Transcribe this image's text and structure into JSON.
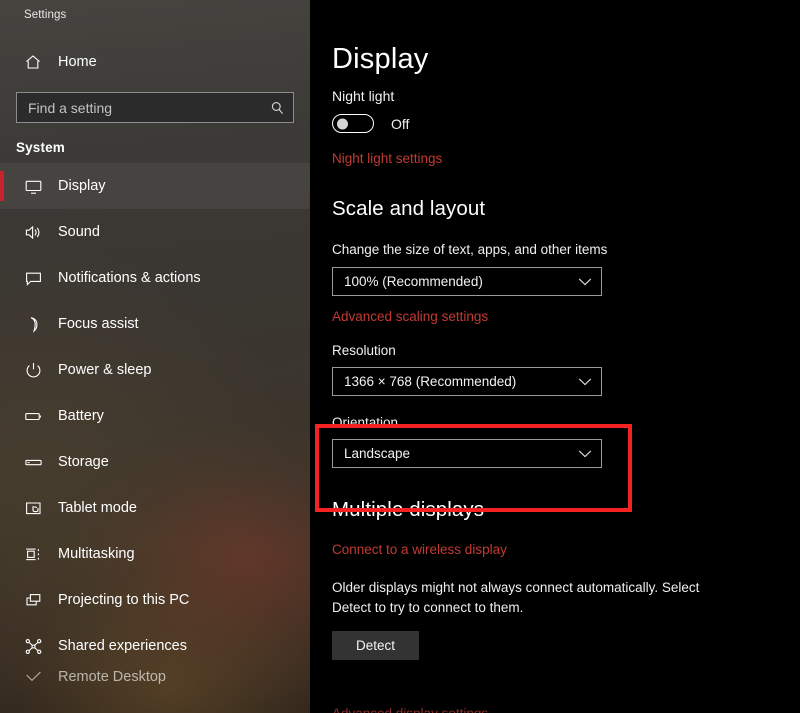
{
  "window": {
    "title": "Settings"
  },
  "sidebar": {
    "home_label": "Home",
    "home_icon": "home-icon",
    "search": {
      "placeholder": "Find a setting",
      "value": "",
      "icon": "search-icon"
    },
    "group_label": "System",
    "accent_color": "#c8232c",
    "items": [
      {
        "label": "Display",
        "icon": "monitor-icon",
        "selected": true
      },
      {
        "label": "Sound",
        "icon": "speaker-icon",
        "selected": false
      },
      {
        "label": "Notifications & actions",
        "icon": "chat-bubble-icon",
        "selected": false
      },
      {
        "label": "Focus assist",
        "icon": "moon-icon",
        "selected": false
      },
      {
        "label": "Power & sleep",
        "icon": "power-icon",
        "selected": false
      },
      {
        "label": "Battery",
        "icon": "battery-icon",
        "selected": false
      },
      {
        "label": "Storage",
        "icon": "storage-icon",
        "selected": false
      },
      {
        "label": "Tablet mode",
        "icon": "tablet-hand-icon",
        "selected": false
      },
      {
        "label": "Multitasking",
        "icon": "multitasking-icon",
        "selected": false
      },
      {
        "label": "Projecting to this PC",
        "icon": "projecting-icon",
        "selected": false
      },
      {
        "label": "Shared experiences",
        "icon": "share-nodes-icon",
        "selected": false
      }
    ],
    "clipped_item": {
      "label": "Remote Desktop",
      "icon": "remote-desktop-icon"
    }
  },
  "main": {
    "page_title": "Display",
    "night_light": {
      "label": "Night light",
      "state": "Off",
      "enabled": false,
      "settings_link": "Night light settings"
    },
    "scale_and_layout": {
      "heading": "Scale and layout",
      "scale_label": "Change the size of text, apps, and other items",
      "scale_value": "100% (Recommended)",
      "advanced_link": "Advanced scaling settings",
      "resolution_label": "Resolution",
      "resolution_value": "1366 × 768 (Recommended)",
      "orientation_label": "Orientation",
      "orientation_value": "Landscape"
    },
    "multiple_displays": {
      "heading": "Multiple displays",
      "wireless_link": "Connect to a wireless display",
      "description": "Older displays might not always connect automatically. Select Detect to try to connect to them.",
      "detect_button": "Detect"
    },
    "clipped_link": "Advanced display settings",
    "link_color": "#c33a33"
  },
  "annotation": {
    "highlight_color": "#f42222",
    "highlight_target": "orientation-field"
  }
}
